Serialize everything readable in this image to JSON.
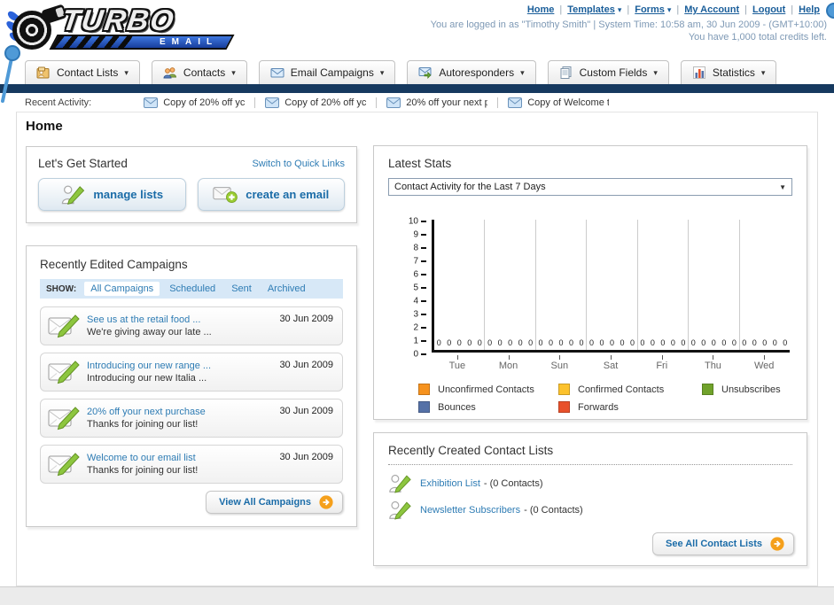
{
  "header": {
    "logo": {
      "top": "TURBO",
      "bottom": "EMAIL"
    },
    "nav": [
      {
        "label": "Home",
        "dropdown": false
      },
      {
        "label": "Templates",
        "dropdown": true
      },
      {
        "label": "Forms",
        "dropdown": true
      },
      {
        "label": "My Account",
        "dropdown": false
      },
      {
        "label": "Logout",
        "dropdown": false
      },
      {
        "label": "Help",
        "dropdown": false
      }
    ],
    "session_text": "You are logged in as \"Timothy Smith\" | System Time: 10:58 am, 30 Jun 2009 - (GMT+10:00)",
    "credits_text": "You have 1,000 total credits left."
  },
  "tabs": [
    {
      "label": "Contact Lists",
      "icon": "contact-lists"
    },
    {
      "label": "Contacts",
      "icon": "contacts"
    },
    {
      "label": "Email Campaigns",
      "icon": "email-campaigns"
    },
    {
      "label": "Autoresponders",
      "icon": "autoresponders"
    },
    {
      "label": "Custom Fields",
      "icon": "custom-fields"
    },
    {
      "label": "Statistics",
      "icon": "statistics"
    }
  ],
  "recent_activity": {
    "label": "Recent Activity:",
    "items": [
      "Copy of 20% off yc",
      "Copy of 20% off yc",
      "20% off your next p",
      "Copy of Welcome tc"
    ]
  },
  "page": {
    "title": "Home"
  },
  "get_started": {
    "title": "Let's Get Started",
    "switch_link": "Switch to Quick Links",
    "buttons": [
      {
        "label": "manage lists",
        "icon": "person-pencil"
      },
      {
        "label": "create an email",
        "icon": "envelope-plus"
      }
    ]
  },
  "campaigns": {
    "title": "Recently Edited Campaigns",
    "show_label": "SHOW:",
    "filters": [
      "All Campaigns",
      "Scheduled",
      "Sent",
      "Archived"
    ],
    "active_filter": "All Campaigns",
    "rows": [
      {
        "title": "See us at the retail food ...",
        "subtitle": "We're giving away our late ...",
        "date": "30 Jun 2009"
      },
      {
        "title": "Introducing our new range ...",
        "subtitle": "Introducing our new Italia ...",
        "date": "30 Jun 2009"
      },
      {
        "title": "20% off your next purchase",
        "subtitle": "Thanks for joining our list!",
        "date": "30 Jun 2009"
      },
      {
        "title": "Welcome to our email list",
        "subtitle": "Thanks for joining our list!",
        "date": "30 Jun 2009"
      }
    ],
    "view_all_label": "View All Campaigns"
  },
  "stats": {
    "title": "Latest Stats",
    "selector_value": "Contact Activity for the Last 7 Days",
    "chart_data": {
      "type": "bar",
      "title": "Contact Activity for the Last 7 Days",
      "categories": [
        "Tue",
        "Mon",
        "Sun",
        "Sat",
        "Fri",
        "Thu",
        "Wed"
      ],
      "series": [
        {
          "name": "Unconfirmed Contacts",
          "color": "#f6921e",
          "values": [
            0,
            0,
            0,
            0,
            0,
            0,
            0
          ]
        },
        {
          "name": "Confirmed Contacts",
          "color": "#fcc22d",
          "values": [
            0,
            0,
            0,
            0,
            0,
            0,
            0
          ]
        },
        {
          "name": "Unsubscribes",
          "color": "#70a22b",
          "values": [
            0,
            0,
            0,
            0,
            0,
            0,
            0
          ]
        },
        {
          "name": "Bounces",
          "color": "#5571a7",
          "values": [
            0,
            0,
            0,
            0,
            0,
            0,
            0
          ]
        },
        {
          "name": "Forwards",
          "color": "#e8512b",
          "values": [
            0,
            0,
            0,
            0,
            0,
            0,
            0
          ]
        }
      ],
      "ylim": [
        0,
        10
      ],
      "yticks": [
        0,
        1,
        2,
        3,
        4,
        5,
        6,
        7,
        8,
        9,
        10
      ],
      "show_value_labels": true,
      "legend_position": "bottom",
      "grid": "vertical"
    }
  },
  "contact_lists": {
    "title": "Recently Created Contact Lists",
    "items": [
      {
        "name": "Exhibition List",
        "detail": "- (0 Contacts)"
      },
      {
        "name": "Newsletter Subscribers",
        "detail": "- (0 Contacts)"
      }
    ],
    "see_all_label": "See All Contact Lists"
  },
  "colors": {
    "navy_bar": "#16395f",
    "link_blue": "#2e7cb4",
    "button_text_blue": "#1b6ca8",
    "show_bar_bg": "#d7e8f7",
    "accent_orange": "#f5a01c"
  }
}
